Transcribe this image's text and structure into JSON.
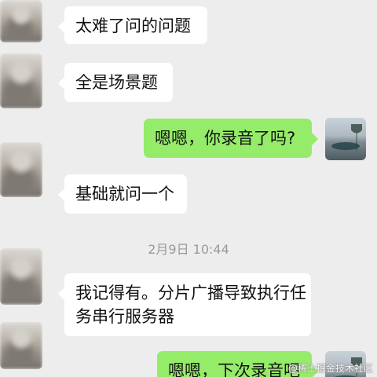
{
  "messages": [
    {
      "side": "left",
      "text": "太难了问的问题"
    },
    {
      "side": "left",
      "text": "全是场景题"
    },
    {
      "side": "right",
      "text": "嗯嗯，你录音了吗?"
    },
    {
      "side": "left",
      "text": "基础就问一个"
    },
    {
      "side": "left",
      "lines": [
        "我记得有。分片广播导致执行任",
        "务串行服务器"
      ]
    },
    {
      "side": "right",
      "text": "嗯嗯，下次录音吧"
    }
  ],
  "timestamp": "2月9日 10:44",
  "watermark": "@稀土掘金技术社区",
  "colors": {
    "background": "#ededed",
    "incoming_bubble": "#ffffff",
    "outgoing_bubble": "#95ec69",
    "timestamp_text": "#999999"
  },
  "icons": {
    "left_avatar": "blurred-user-avatar",
    "right_avatar": "lake-photo-avatar"
  }
}
